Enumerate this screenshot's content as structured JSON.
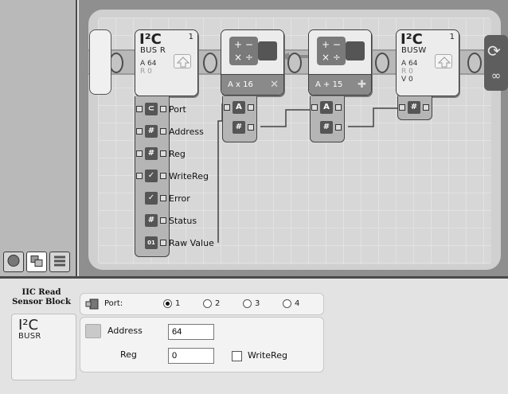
{
  "program": {
    "blocks": {
      "i2c_read": {
        "logo": "I²C",
        "bus_label": "BUS R",
        "number": "1",
        "line1": "A 64",
        "line2": "R 0"
      },
      "math1": {
        "keypad": "+ −\n× ÷",
        "label": "A x 16",
        "op_icon": "multiply-icon"
      },
      "math2": {
        "keypad": "+ −\n× ÷",
        "label": "A + 15",
        "op_icon": "add-icon"
      },
      "i2c_write": {
        "logo": "I²C",
        "bus_label": "BUSW",
        "number": "1",
        "line1": "A 64",
        "line2": "R 0",
        "line3": "V 0"
      }
    },
    "read_hub_plugs": [
      {
        "icon": "port-icon",
        "glyph": "⊂",
        "label": "Port"
      },
      {
        "icon": "number-icon",
        "glyph": "#",
        "label": "Address"
      },
      {
        "icon": "number-icon",
        "glyph": "#",
        "label": "Reg"
      },
      {
        "icon": "boolean-icon",
        "glyph": "✓",
        "label": "WriteReg"
      },
      {
        "icon": "boolean-icon",
        "glyph": "✓",
        "label": "Error"
      },
      {
        "icon": "number-icon",
        "glyph": "#",
        "label": "Status"
      },
      {
        "icon": "binary-icon",
        "glyph": "01",
        "label": "Raw Value"
      }
    ],
    "math_hub_plugs": [
      {
        "glyph": "A"
      },
      {
        "glyph": "#"
      }
    ],
    "write_hub_plugs": [
      {
        "glyph": "#"
      }
    ]
  },
  "config": {
    "block_title": "IIC Read Sensor Block",
    "preview": {
      "logo": "I²C",
      "bus_label": "BUSR"
    },
    "port": {
      "label": "Port:",
      "options": [
        "1",
        "2",
        "3",
        "4"
      ],
      "selected": "1"
    },
    "address": {
      "label": "Address",
      "value": "64"
    },
    "reg": {
      "label": "Reg",
      "value": "0"
    },
    "writereg": {
      "label": "WriteReg",
      "checked": false
    }
  }
}
